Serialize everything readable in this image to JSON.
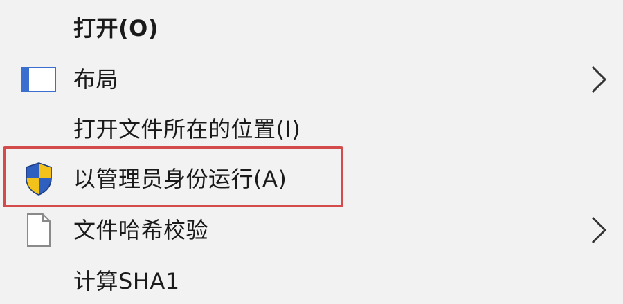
{
  "context_menu": {
    "items": [
      {
        "label": "打开(O)",
        "icon": null,
        "submenu": false,
        "bold": true
      },
      {
        "label": "布局",
        "icon": "layout-window-icon",
        "submenu": true,
        "bold": false
      },
      {
        "label": "打开文件所在的位置(I)",
        "icon": null,
        "submenu": false,
        "bold": false
      },
      {
        "label": "以管理员身份运行(A)",
        "icon": "uac-shield-icon",
        "submenu": false,
        "bold": false,
        "highlighted": true
      },
      {
        "label": "文件哈希校验",
        "icon": "file-icon",
        "submenu": true,
        "bold": false
      },
      {
        "label": "计算SHA1",
        "icon": null,
        "submenu": false,
        "bold": false
      }
    ]
  },
  "colors": {
    "menu_background": "#f2f2f2",
    "text": "#1a1a1a",
    "highlight_border": "#d44b4b",
    "shield_blue": "#2f5fbf",
    "shield_yellow": "#f2c21b"
  }
}
